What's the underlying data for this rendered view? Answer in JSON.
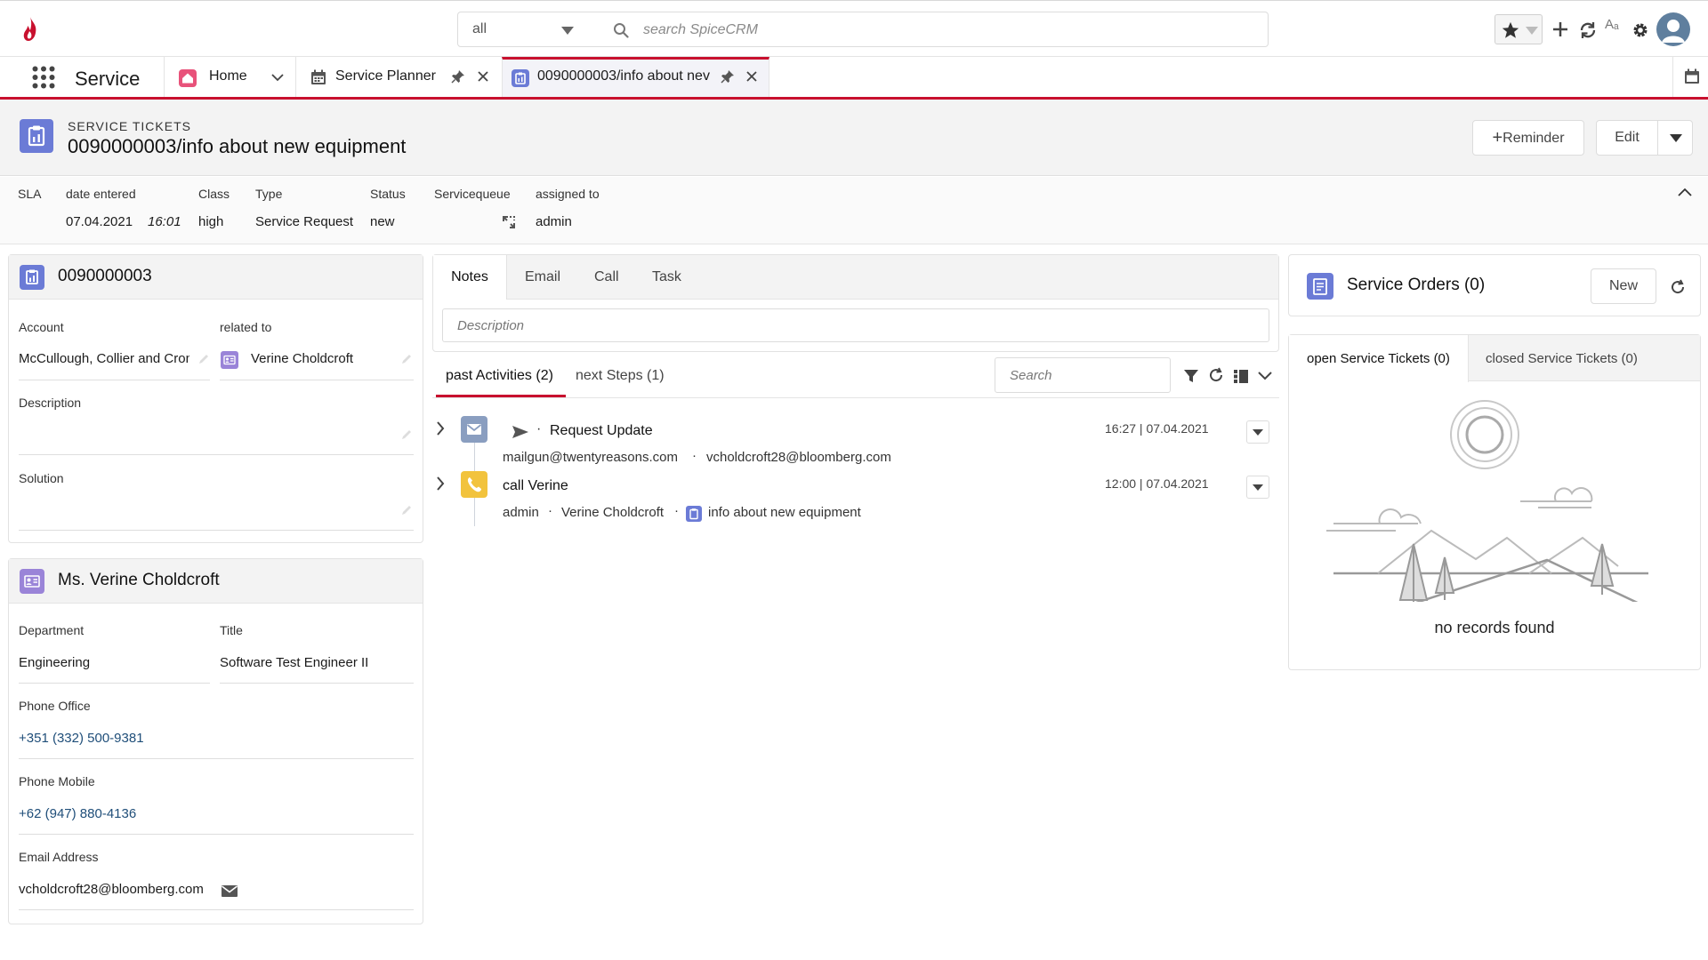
{
  "topbar": {
    "scope_value": "all",
    "search_placeholder": "search SpiceCRM",
    "font_icon_label": "Aₐ"
  },
  "tabbar": {
    "app_name": "Service",
    "tabs": [
      {
        "label": "Home"
      },
      {
        "label": "Service Planner"
      },
      {
        "label": "0090000003/info about nev"
      }
    ]
  },
  "record": {
    "module": "SERVICE TICKETS",
    "title": "0090000003/info about new equipment",
    "reminder_label": "Reminder",
    "edit_label": "Edit"
  },
  "summary": {
    "labels": {
      "sla": "SLA",
      "date_entered": "date entered",
      "class": "Class",
      "type": "Type",
      "status": "Status",
      "servicequeue": "Servicequeue",
      "assigned_to": "assigned to"
    },
    "values": {
      "date": "07.04.2021",
      "time": "16:01",
      "class": "high",
      "type": "Service Request",
      "status": "new",
      "assigned_to": "admin"
    }
  },
  "ticket_panel": {
    "title": "0090000003",
    "account_label": "Account",
    "account_value": "McCullough, Collier and Cron",
    "related_label": "related to",
    "related_value": "Verine Choldcroft",
    "description_label": "Description",
    "solution_label": "Solution"
  },
  "contact_panel": {
    "title": "Ms. Verine Choldcroft",
    "department_label": "Department",
    "department_value": "Engineering",
    "title_label": "Title",
    "title_value": "Software Test Engineer II",
    "phone_office_label": "Phone Office",
    "phone_office_value": "+351 (332) 500-9381",
    "phone_mobile_label": "Phone Mobile",
    "phone_mobile_value": "+62 (947) 880-4136",
    "email_label": "Email Address",
    "email_value": "vcholdcroft28@bloomberg.com"
  },
  "activities": {
    "compose_tabs": [
      "Notes",
      "Email",
      "Call",
      "Task"
    ],
    "description_placeholder": "Description",
    "history_tabs": [
      "past Activities (2)",
      "next Steps (1)"
    ],
    "search_placeholder": "Search",
    "items": [
      {
        "title": "Request Update",
        "time": "16:27 | 07.04.2021",
        "from": "mailgun@twentyreasons.com",
        "to": "vcholdcroft28@bloomberg.com",
        "separator": "·",
        "icon": "mail-icon",
        "color": "#8a9ec0"
      },
      {
        "title": "call Verine",
        "time": "12:00 | 07.04.2021",
        "user": "admin",
        "contact": "Verine Choldcroft",
        "related": "info about new equipment",
        "separator": "·",
        "icon": "phone-icon",
        "color": "#f2c33d"
      }
    ]
  },
  "service_orders": {
    "title": "Service Orders (0)",
    "new_label": "New"
  },
  "service_tickets": {
    "tabs": [
      "open Service Tickets (0)",
      "closed Service Tickets (0)"
    ],
    "empty_text": "no records found"
  },
  "colors": {
    "accent_red": "#c8102e",
    "ticket_icon": "#6b7bd6",
    "contact_icon": "#9a84d8"
  }
}
